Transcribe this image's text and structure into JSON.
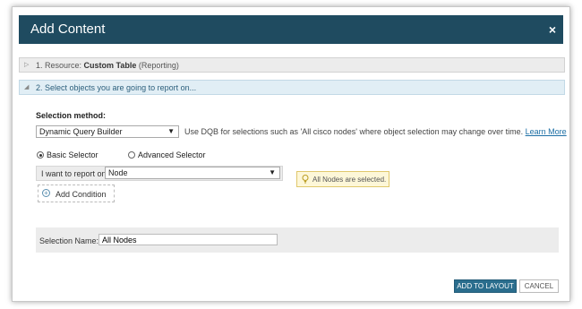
{
  "dialog": {
    "title": "Add Content",
    "close_icon": "×"
  },
  "section1": {
    "prefix": "1. Resource:",
    "resource": "Custom Table",
    "suffix": "(Reporting)",
    "arrow_icon": "▷"
  },
  "section2": {
    "label": "2. Select objects you are going to report on...",
    "arrow_icon": "◢"
  },
  "selection": {
    "method_label": "Selection method:",
    "method_value": "Dynamic Query Builder",
    "hint": "Use DQB for selections such as 'All cisco nodes' where object selection may change over time.",
    "learn_more": "Learn More"
  },
  "selectors": {
    "basic": "Basic Selector",
    "advanced": "Advanced Selector",
    "selected": "basic"
  },
  "report": {
    "label": "I want to report on",
    "value": "Node"
  },
  "info": {
    "text": "All Nodes are selected."
  },
  "add_condition": {
    "label": "Add Condition"
  },
  "selection_name": {
    "label": "Selection Name:",
    "value": "All Nodes"
  },
  "buttons": {
    "add": "ADD TO LAYOUT",
    "cancel": "CANCEL"
  },
  "colors": {
    "titlebar": "#1f4b60",
    "primary_button": "#2a6d8d",
    "link": "#1d6fa5",
    "info_bg": "#fdf7d8"
  }
}
